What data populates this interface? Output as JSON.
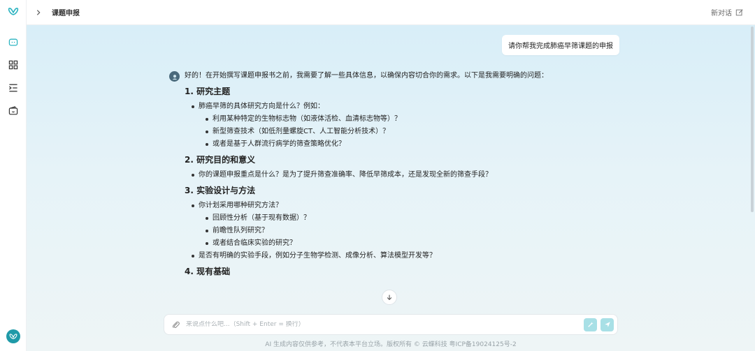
{
  "header": {
    "breadcrumb": "课题申报",
    "new_chat_label": "新对话"
  },
  "sidebar": {
    "items": [
      {
        "icon": "chat-icon"
      },
      {
        "icon": "grid-icon"
      },
      {
        "icon": "list-indent-icon"
      },
      {
        "icon": "wallet-icon"
      }
    ]
  },
  "conversation": {
    "user_message": "请你帮我完成肺癌早筛课题的申报",
    "reply_intro": "好的！在开始撰写课题申报书之前，我需要了解一些具体信息，以确保内容切合你的需求。以下是我需要明确的问题：",
    "sections": [
      {
        "title": "1. 研究主题",
        "items": [
          {
            "text": "肺癌早筛的具体研究方向是什么？例如：",
            "sub": [
              "利用某种特定的生物标志物（如液体活检、血清标志物等）？",
              "新型筛查技术（如低剂量螺旋CT、人工智能分析技术）？",
              "或者是基于人群流行病学的筛查策略优化？"
            ]
          }
        ]
      },
      {
        "title": "2. 研究目的和意义",
        "items": [
          {
            "text": "你的课题申报重点是什么？是为了提升筛查准确率、降低早筛成本，还是发现全新的筛查手段？",
            "sub": []
          }
        ]
      },
      {
        "title": "3. 实验设计与方法",
        "items": [
          {
            "text": "你计划采用哪种研究方法？",
            "sub": [
              "回顾性分析（基于现有数据）？",
              "前瞻性队列研究？",
              "或者结合临床实验的研究？"
            ]
          },
          {
            "text": "是否有明确的实验手段，例如分子生物学检测、成像分析、算法模型开发等？",
            "sub": []
          }
        ]
      },
      {
        "title": "4. 现有基础",
        "items": []
      }
    ]
  },
  "input": {
    "placeholder": "来说点什么吧...（Shift + Enter = 换行）",
    "value": ""
  },
  "footer": {
    "text": "AI 生成内容仅供参考，不代表本平台立场。版权所有 © 云蝶科技  粤ICP备19024125号-2"
  },
  "colors": {
    "accent": "#2bb3c0",
    "send_button_bg": "#a8e0e6",
    "main_bg_top": "#d8eef8"
  }
}
